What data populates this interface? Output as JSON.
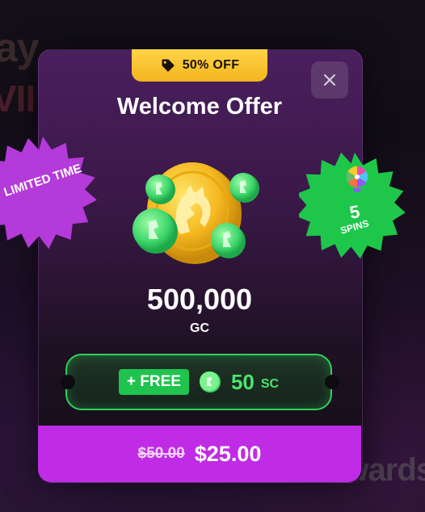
{
  "background": {
    "text_1": "ay",
    "text_2": "VII",
    "text_3": "wards"
  },
  "modal": {
    "ribbon_label": "50% OFF",
    "title": "Welcome Offer",
    "gc_amount": "500,000",
    "gc_unit": "GC",
    "bonus": {
      "free_label": "+ FREE",
      "sc_amount": "50",
      "sc_unit": "SC"
    },
    "price": {
      "old": "$50.00",
      "new": "$25.00"
    },
    "close_icon": "close-icon"
  },
  "badges": {
    "limited_time": "LIMITED TIME",
    "spins_count": "5",
    "spins_label": "SPINS"
  },
  "colors": {
    "accent_purple": "#c02ce6",
    "ribbon_yellow": "#ffd447",
    "free_green": "#1fc34e",
    "sc_green": "#4be36e",
    "spins_badge_green": "#1ec74a",
    "limited_badge_purple": "#b43ad9"
  }
}
